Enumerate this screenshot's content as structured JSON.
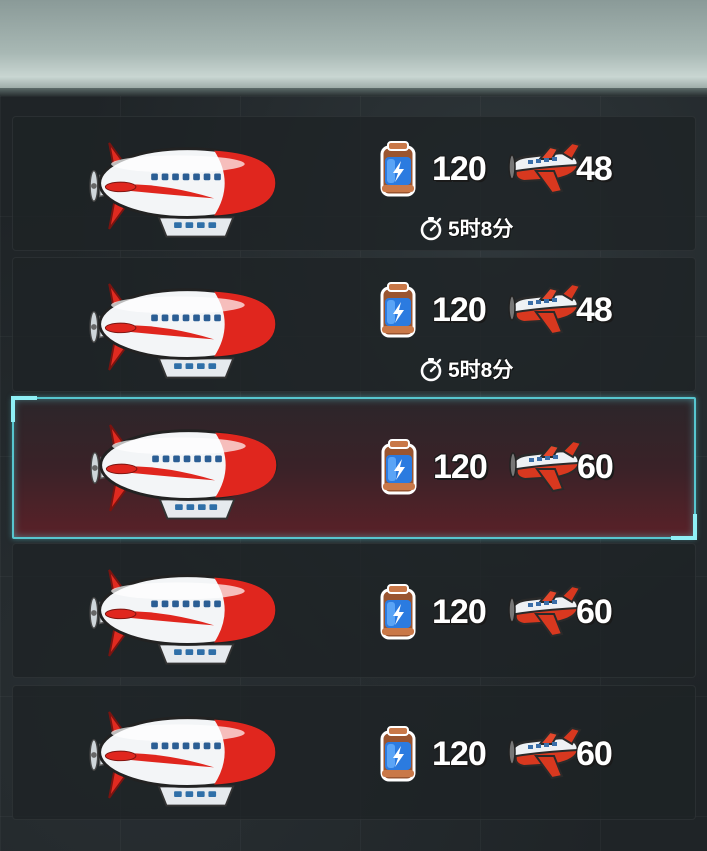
{
  "rows": [
    {
      "energy": "120",
      "planes": "48",
      "timer": "5时8分",
      "selected": false
    },
    {
      "energy": "120",
      "planes": "48",
      "timer": "5时8分",
      "selected": false
    },
    {
      "energy": "120",
      "planes": "60",
      "selected": true
    },
    {
      "energy": "120",
      "planes": "60",
      "selected": false
    },
    {
      "energy": "120",
      "planes": "60",
      "selected": false
    }
  ],
  "icons": {
    "airship": "airship-icon",
    "energy": "battery-icon",
    "plane": "plane-icon",
    "timer": "stopwatch-icon"
  },
  "colors": {
    "selected_border": "#57c6cf",
    "selected_fill": "#5a2128",
    "airship_red": "#e0261e"
  }
}
